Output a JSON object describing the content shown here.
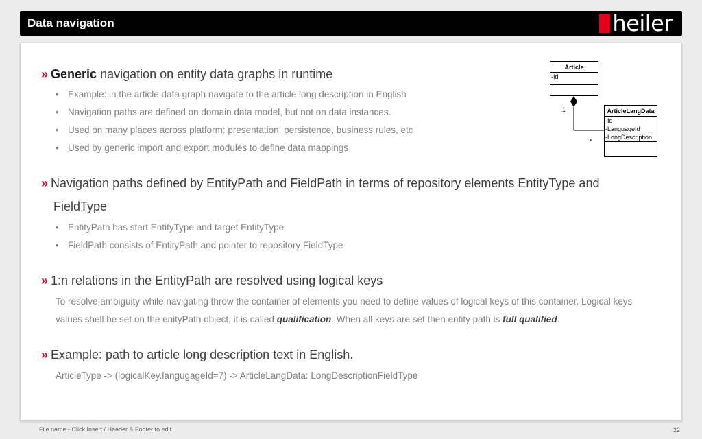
{
  "header": {
    "title": "Data navigation",
    "logo_text": "heiler",
    "logo_color": "#e2001a"
  },
  "sections": [
    {
      "lead_bold": "Generic",
      "lead_rest": " navigation on entity data graphs in runtime",
      "bullets": [
        "Example: in the article data graph navigate to the article long description in English",
        "Navigation paths are defined on domain data model, but not on data instances.",
        "Used on many places across platform: presentation, persistence, business rules, etc",
        "Used by generic  import and export modules to define data mappings"
      ]
    },
    {
      "heading_line1": "Navigation paths  defined by EntityPath and FieldPath in terms of repository elements EntityType and",
      "heading_line2": "FieldType",
      "bullets": [
        "EntityPath has start EntityType and target EntityType",
        "FieldPath consists of EntityPath and pointer to repository FieldType"
      ]
    },
    {
      "heading": "1:n relations in the EntityPath are resolved using logical keys",
      "para_line1": "To resolve ambiguity while navigating throw the container of elements you need to define values of logical keys of this container.  Logical keys",
      "para_line2_a": "values shell be set on the enityPath object, it is called ",
      "para_line2_em1": "qualification",
      "para_line2_b": ". When all keys are set then entity path is ",
      "para_line2_em2": "full qualified",
      "para_line2_c": "."
    },
    {
      "heading": "Example: path to article long description text in English.",
      "code": "ArticleType -> (logicalKey.langugageId=7) -> ArticleLangData: LongDescriptionFieldType"
    }
  ],
  "uml": {
    "class1": {
      "name": "Article",
      "attrs": [
        "-Id"
      ]
    },
    "class2": {
      "name": "ArticleLangData",
      "attrs": [
        "-Id",
        "-LanguageId",
        "-LongDescription"
      ]
    },
    "mult_one": "1",
    "mult_many": "*"
  },
  "chevron": "»",
  "bullet_glyph": "•",
  "footer": {
    "left": "File name - Click Insert / Header & Footer to edit",
    "page": "22"
  }
}
